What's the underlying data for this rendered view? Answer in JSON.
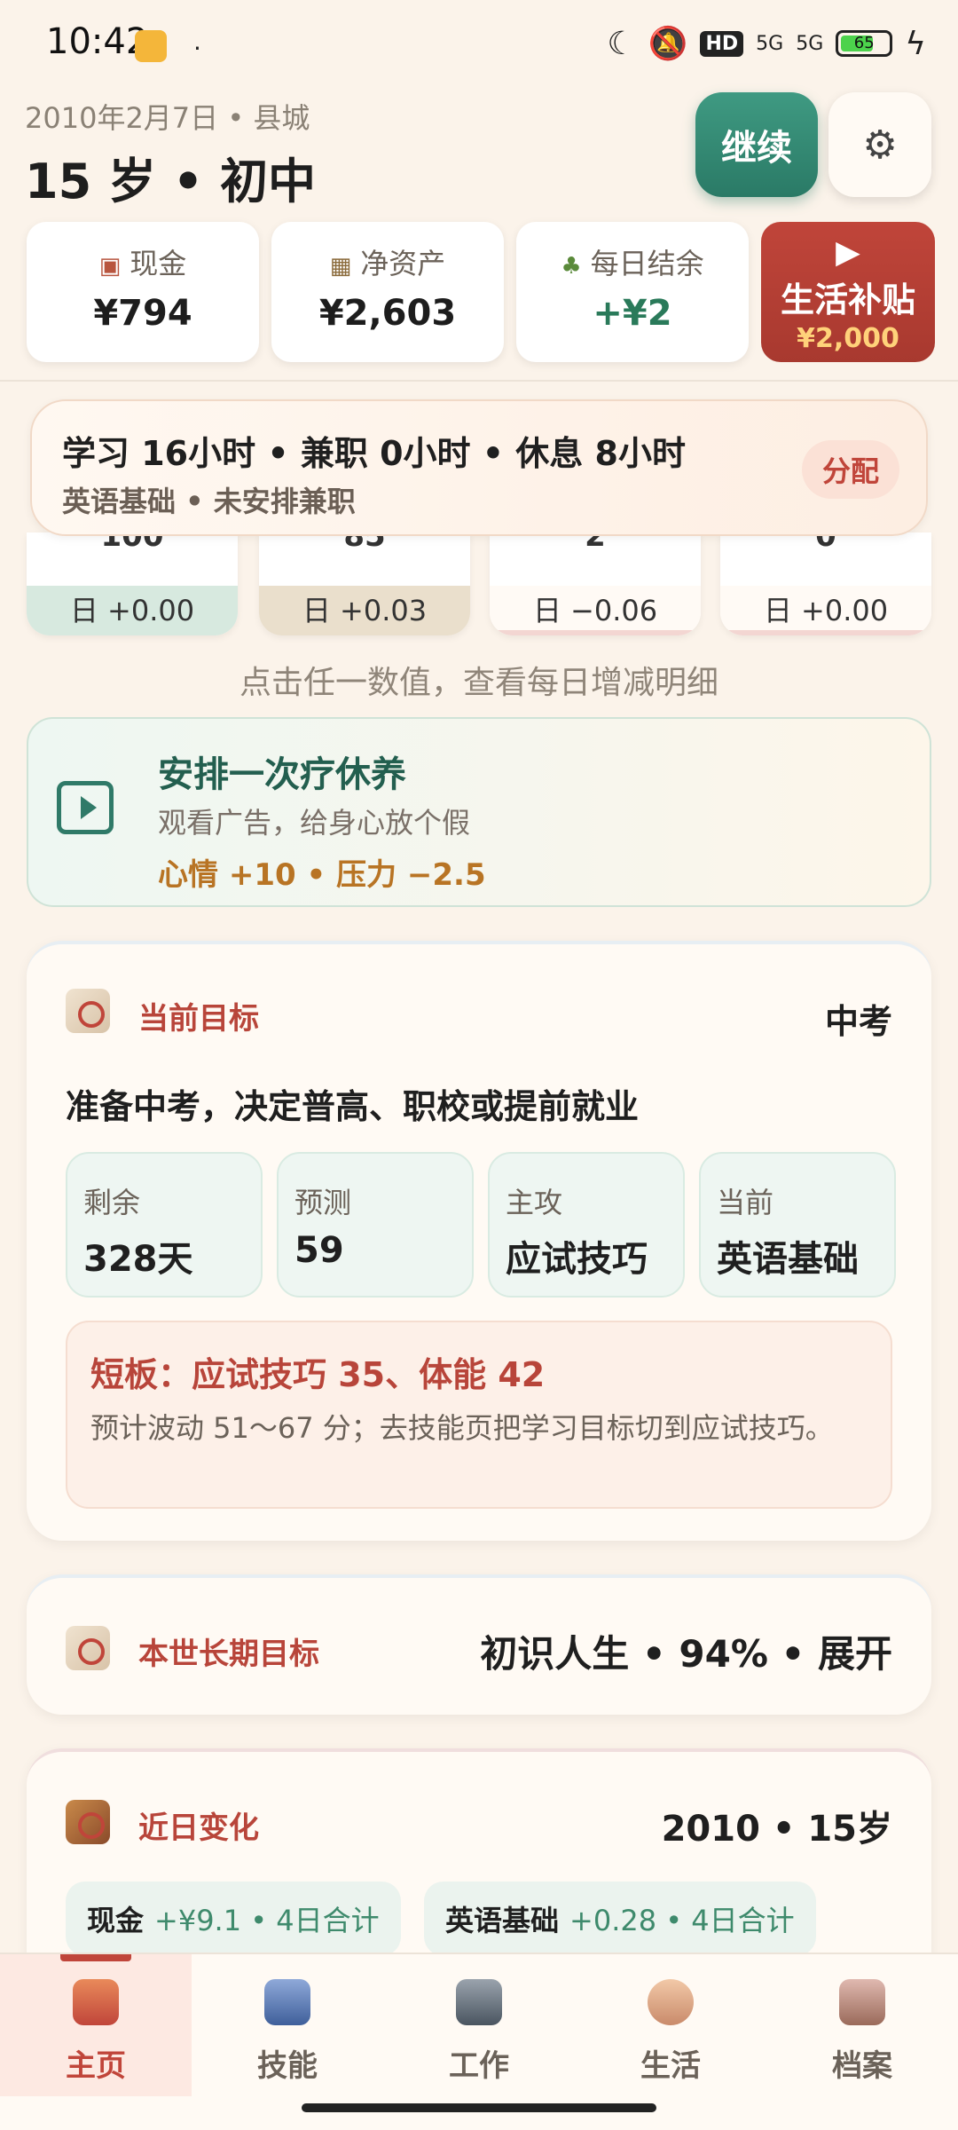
{
  "status_bar": {
    "time": "10:42",
    "dot": "·",
    "network": "5G",
    "hd": "HD",
    "battery": "65"
  },
  "header": {
    "date_place": "2010年2月7日 • 县城",
    "age_stage": "15 岁 • 初中",
    "continue_label": "继续",
    "settings_icon": "gear-icon"
  },
  "money": {
    "cash": {
      "label": "现金",
      "value": "¥794"
    },
    "net_assets": {
      "label": "净资产",
      "value": "¥2,603"
    },
    "daily_balance": {
      "label": "每日结余",
      "value": "+¥2"
    },
    "subsidy": {
      "title": "生活补贴",
      "amount": "¥2,000"
    }
  },
  "allocation": {
    "summary": "学习 16小时 • 兼职 0小时 • 休息 8小时",
    "detail": "英语基础 • 未安排兼职",
    "button": "分配"
  },
  "stats": [
    {
      "num": "100",
      "delta": "日 +0.00",
      "tint": "green"
    },
    {
      "num": "85",
      "delta": "日 +0.03",
      "tint": "tan"
    },
    {
      "num": "2",
      "delta": "日 −0.06",
      "tint": "white"
    },
    {
      "num": "0",
      "delta": "日 +0.00",
      "tint": "white"
    }
  ],
  "hint": "点击任一数值，查看每日增减明细",
  "rest": {
    "title": "安排一次疗休养",
    "desc": "观看广告，给身心放个假",
    "effect": "心情 +10 • 压力 −2.5"
  },
  "goal": {
    "label": "当前目标",
    "exam": "中考",
    "desc": "准备中考，决定普高、职校或提前就业",
    "tiles": [
      {
        "label": "剩余",
        "value": "328天"
      },
      {
        "label": "预测",
        "value": "59"
      },
      {
        "label": "主攻",
        "value": "应试技巧"
      },
      {
        "label": "当前",
        "value": "英语基础"
      }
    ],
    "weak_title": "短板：应试技巧 35、体能 42",
    "weak_text": "预计波动 51～67 分；去技能页把学习目标切到应试技巧。"
  },
  "long_term": {
    "label": "本世长期目标",
    "summary": "初识人生 • 94% • 展开"
  },
  "recent": {
    "label": "近日变化",
    "summary": "2010 • 15岁",
    "chips": [
      {
        "name": "现金",
        "detail": "+¥9.1 • 4日合计"
      },
      {
        "name": "英语基础",
        "detail": "+0.28 • 4日合计"
      }
    ]
  },
  "nav": [
    {
      "label": "主页",
      "icon": "home-icon"
    },
    {
      "label": "技能",
      "icon": "book-icon"
    },
    {
      "label": "工作",
      "icon": "briefcase-icon"
    },
    {
      "label": "生活",
      "icon": "person-icon"
    },
    {
      "label": "档案",
      "icon": "archive-icon"
    }
  ],
  "colors": {
    "accent_red": "#c0453a",
    "accent_green": "#2a7a66",
    "background": "#fbf3ea"
  }
}
